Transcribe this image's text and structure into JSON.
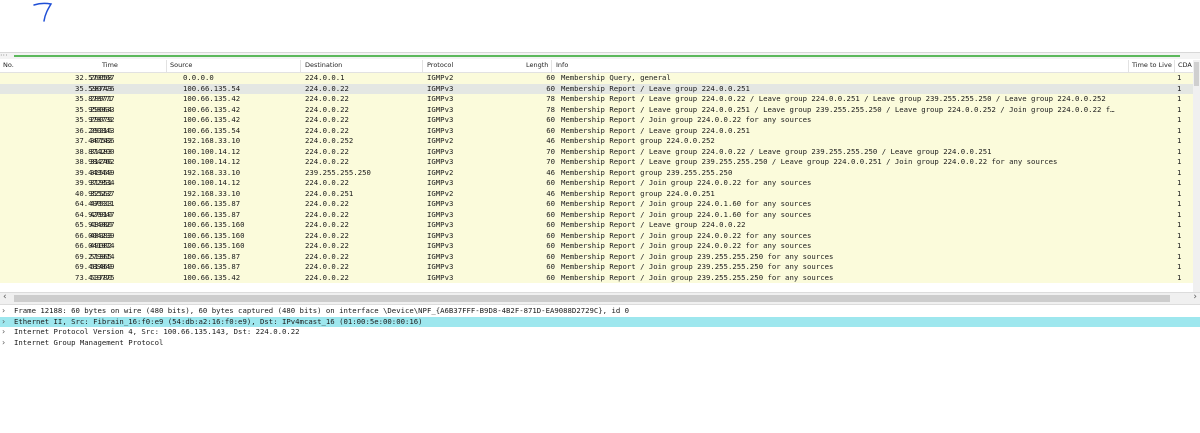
{
  "columns": {
    "no": "No.",
    "time": "Time",
    "source": "Source",
    "destination": "Destination",
    "protocol": "Protocol",
    "length": "Length",
    "info": "Info",
    "ttl": "Time to Live",
    "cda": "CDA"
  },
  "packets": [
    {
      "no": "26058",
      "time": "32.570567",
      "src": "0.0.0.0",
      "dst": "224.0.0.1",
      "proto": "IGMPv2",
      "len": "60",
      "info": "Membership Query, general",
      "ttl": "1"
    },
    {
      "no": "28743",
      "time": "35.590776",
      "src": "100.66.135.54",
      "dst": "224.0.0.22",
      "proto": "IGMPv3",
      "len": "60",
      "info": "Membership Report / Leave group 224.0.0.251",
      "ttl": "1"
    },
    {
      "no": "28971",
      "time": "35.878777",
      "src": "100.66.135.42",
      "dst": "224.0.0.22",
      "proto": "IGMPv3",
      "len": "78",
      "info": "Membership Report / Leave group 224.0.0.22 / Leave group 224.0.0.251 / Leave group 239.255.255.250 / Leave group 224.0.0.252",
      "ttl": "1"
    },
    {
      "no": "29064",
      "time": "35.958933",
      "src": "100.66.135.42",
      "dst": "224.0.0.22",
      "proto": "IGMPv3",
      "len": "78",
      "info": "Membership Report / Leave group 224.0.0.251 / Leave group 239.255.255.250 / Leave group 224.0.0.252 / Join group 224.0.0.22 f…",
      "ttl": "1"
    },
    {
      "no": "29079",
      "time": "35.978732",
      "src": "100.66.135.42",
      "dst": "224.0.0.22",
      "proto": "IGMPv3",
      "len": "60",
      "info": "Membership Report / Join group 224.0.0.22 for any sources",
      "ttl": "1"
    },
    {
      "no": "29216",
      "time": "36.200843",
      "src": "100.66.135.54",
      "dst": "224.0.0.22",
      "proto": "IGMPv3",
      "len": "60",
      "info": "Membership Report / Leave group 224.0.0.251",
      "ttl": "1"
    },
    {
      "no": "30142",
      "time": "37.447586",
      "src": "192.168.33.10",
      "dst": "224.0.0.252",
      "proto": "IGMPv2",
      "len": "46",
      "info": "Membership Report group 224.0.0.252",
      "ttl": "1"
    },
    {
      "no": "31183",
      "time": "38.874200",
      "src": "100.100.14.12",
      "dst": "224.0.0.22",
      "proto": "IGMPv3",
      "len": "70",
      "info": "Membership Report / Leave group 224.0.0.22 / Leave group 239.255.255.250 / Leave group 224.0.0.251",
      "ttl": "1"
    },
    {
      "no": "31246",
      "time": "38.984762",
      "src": "100.100.14.12",
      "dst": "224.0.0.22",
      "proto": "IGMPv3",
      "len": "70",
      "info": "Membership Report / Leave group 239.255.255.250 / Leave group 224.0.0.251 / Join group 224.0.0.22 for any sources",
      "ttl": "1"
    },
    {
      "no": "31569",
      "time": "39.449449",
      "src": "192.168.33.10",
      "dst": "239.255.255.250",
      "proto": "IGMPv2",
      "len": "46",
      "info": "Membership Report group 239.255.255.250",
      "ttl": "1"
    },
    {
      "no": "31951",
      "time": "39.972834",
      "src": "100.100.14.12",
      "dst": "224.0.0.22",
      "proto": "IGMPv3",
      "len": "60",
      "info": "Membership Report / Join group 224.0.0.22 for any sources",
      "ttl": "1"
    },
    {
      "no": "32562",
      "time": "40.955237",
      "src": "192.168.33.10",
      "dst": "224.0.0.251",
      "proto": "IGMPv2",
      "len": "46",
      "info": "Membership Report group 224.0.0.251",
      "ttl": "1"
    },
    {
      "no": "47533",
      "time": "64.490011",
      "src": "100.66.135.87",
      "dst": "224.0.0.22",
      "proto": "IGMPv3",
      "len": "60",
      "info": "Membership Report / Join group 224.0.1.60 for any sources",
      "ttl": "1"
    },
    {
      "no": "47910",
      "time": "64.920047",
      "src": "100.66.135.87",
      "dst": "224.0.0.22",
      "proto": "IGMPv3",
      "len": "60",
      "info": "Membership Report / Join group 224.0.1.60 for any sources",
      "ttl": "1"
    },
    {
      "no": "48900",
      "time": "65.914027",
      "src": "100.66.135.160",
      "dst": "224.0.0.22",
      "proto": "IGMPv3",
      "len": "60",
      "info": "Membership Report / Leave group 224.0.0.22",
      "ttl": "1"
    },
    {
      "no": "48983",
      "time": "66.004239",
      "src": "100.66.135.160",
      "dst": "224.0.0.22",
      "proto": "IGMPv3",
      "len": "60",
      "info": "Membership Report / Join group 224.0.0.22 for any sources",
      "ttl": "1"
    },
    {
      "no": "49002",
      "time": "66.041974",
      "src": "100.66.135.160",
      "dst": "224.0.0.22",
      "proto": "IGMPv3",
      "len": "60",
      "info": "Membership Report / Join group 224.0.0.22 for any sources",
      "ttl": "1"
    },
    {
      "no": "51365",
      "time": "69.279914",
      "src": "100.66.135.87",
      "dst": "224.0.0.22",
      "proto": "IGMPv3",
      "len": "60",
      "info": "Membership Report / Join group 239.255.255.250 for any sources",
      "ttl": "1"
    },
    {
      "no": "51469",
      "time": "69.489849",
      "src": "100.66.135.87",
      "dst": "224.0.0.22",
      "proto": "IGMPv3",
      "len": "60",
      "info": "Membership Report / Join group 239.255.255.250 for any sources",
      "ttl": "1"
    },
    {
      "no": "53780",
      "time": "73.419775",
      "src": "100.66.135.42",
      "dst": "224.0.0.22",
      "proto": "IGMPv3",
      "len": "60",
      "info": "Membership Report / Join group 239.255.255.250 for any sources",
      "ttl": "1"
    }
  ],
  "selected_packet_index": 1,
  "details": [
    {
      "text": "Frame 12188: 60 bytes on wire (480 bits), 60 bytes captured (480 bits) on interface \\Device\\NPF_{A6B37FFF-B9D8-4B2F-871D-EA9088D2729C}, id 0",
      "selected": false
    },
    {
      "text": "Ethernet II, Src: Fibrain_16:f0:e9 (54:db:a2:16:f0:e9), Dst: IPv4mcast_16 (01:00:5e:00:00:16)",
      "selected": true
    },
    {
      "text": "Internet Protocol Version 4, Src: 100.66.135.143, Dst: 224.0.0.22",
      "selected": false
    },
    {
      "text": "Internet Group Management Protocol",
      "selected": false
    }
  ],
  "icons": {
    "expand": "chevron-right-icon",
    "scroll_left": "chevron-left-icon",
    "scroll_right": "chevron-right-icon"
  },
  "colors": {
    "row_bg": "#fbfbdb",
    "row_selected_bg": "#e4e7e3",
    "detail_selected_bg": "#9ee7ee",
    "status_bar": "#5cb85c",
    "annotation": "#1f4fd6"
  }
}
